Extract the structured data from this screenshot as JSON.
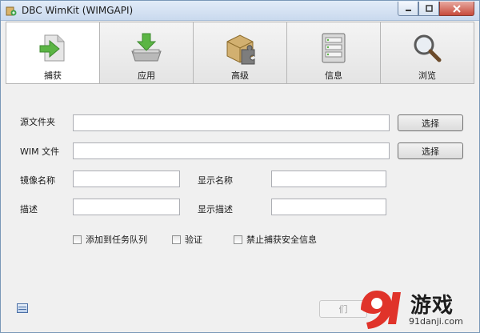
{
  "window": {
    "title": "DBC WimKit (WIMGAPI)"
  },
  "toolbar": {
    "items": [
      {
        "label": "捕获",
        "icon": "capture-icon",
        "active": true
      },
      {
        "label": "应用",
        "icon": "apply-icon",
        "active": false
      },
      {
        "label": "高级",
        "icon": "advanced-icon",
        "active": false
      },
      {
        "label": "信息",
        "icon": "info-icon",
        "active": false
      },
      {
        "label": "浏览",
        "icon": "browse-icon",
        "active": false
      }
    ]
  },
  "form": {
    "source_folder_label": "源文件夹",
    "source_folder_value": "",
    "wim_file_label": "WIM 文件",
    "wim_file_value": "",
    "browse_label": "选择",
    "image_name_label": "镜像名称",
    "image_name_value": "",
    "display_name_label": "显示名称",
    "display_name_value": "",
    "description_label": "描述",
    "description_value": "",
    "display_description_label": "显示描述",
    "display_description_value": "",
    "checkboxes": [
      {
        "label": "添加到任务队列",
        "checked": false
      },
      {
        "label": "验证",
        "checked": false
      },
      {
        "label": "禁止捕获安全信息",
        "checked": false
      }
    ]
  },
  "footer": {
    "action_button_label": "们"
  },
  "watermark": {
    "brand": "游戏",
    "url": "91danji.com"
  },
  "colors": {
    "accent_green": "#5bb544",
    "window_border": "#7a98b8"
  }
}
